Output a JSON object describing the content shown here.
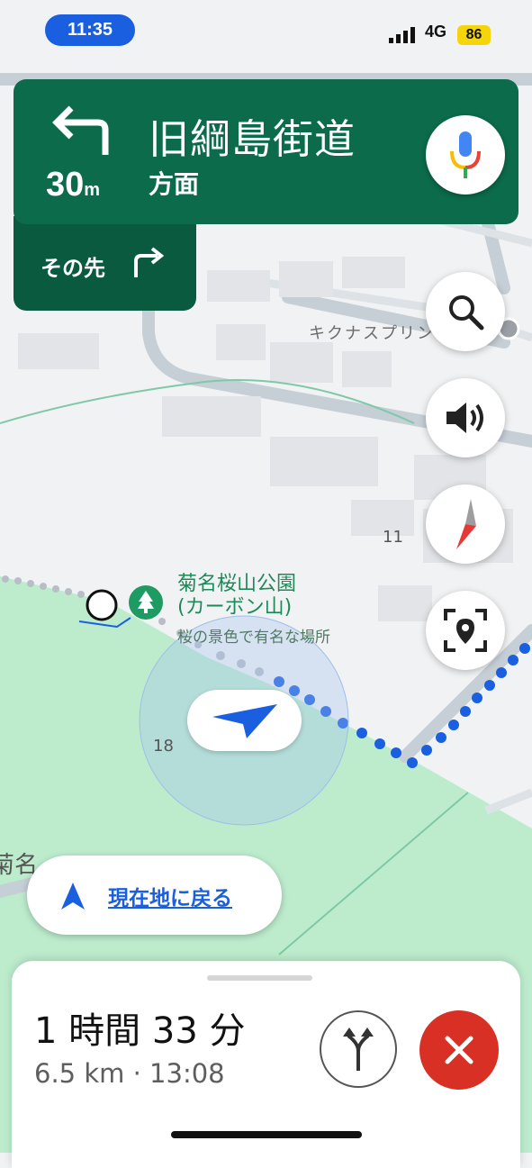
{
  "status_bar": {
    "time": "11:35",
    "network": "4G",
    "battery": "86"
  },
  "navigation": {
    "distance_value": "30",
    "distance_unit": "m",
    "street": "旧綱島街道",
    "direction": "方面",
    "then_label": "その先",
    "turn_icon": "turn-left-icon",
    "then_icon": "turn-right-icon"
  },
  "map": {
    "poi_name_line1": "菊名桜山公園",
    "poi_name_line2": "(カーボン山)",
    "poi_description": "桜の景色で有名な場所",
    "place_label": "キクナスプリン",
    "road_number_1": "11",
    "road_number_2": "18",
    "area_label": "菊名"
  },
  "controls": [
    "search-icon",
    "speaker-icon",
    "compass-icon",
    "report-location-icon"
  ],
  "recenter": {
    "label": "現在地に戻る"
  },
  "trip": {
    "duration": "1 時間 33 分",
    "summary": "6.5 km · 13:08"
  },
  "colors": {
    "nav_green": "#0b6b4b",
    "route_blue": "#1a5fe0",
    "park_green": "#bdeccd",
    "close_red": "#d93025"
  }
}
